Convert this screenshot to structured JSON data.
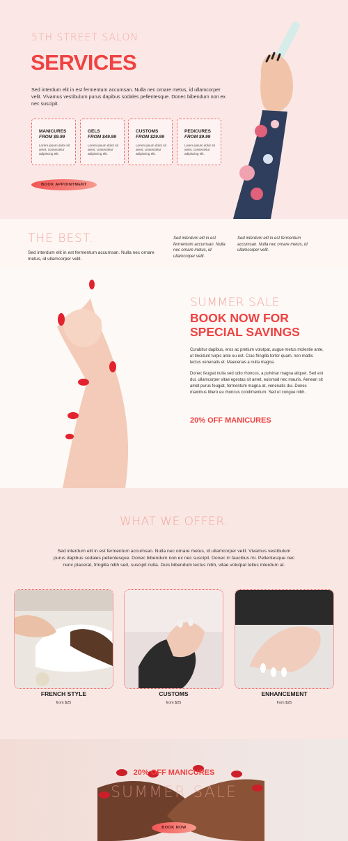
{
  "hero": {
    "eyebrow": "5TH STREET SALON",
    "title": "SERVICES",
    "text": "Sed interdum elit in est fermentum accumsan. Nulla nec ornare metus, id ullamcorper velit. Vivamus vestibulum purus dapibus sodales pellentesque. Donec bibendum non ex nec suscipit.",
    "cards": [
      {
        "name": "MANICURES",
        "price": "FROM $9.99",
        "desc": "Lorem ipsum dolor sit amet, consectetur adipiscing elit."
      },
      {
        "name": "GELS",
        "price": "FROM $49.99",
        "desc": "Lorem ipsum dolor sit amet, consectetur adipiscing elit."
      },
      {
        "name": "CUSTOMS",
        "price": "FROM $29.99",
        "desc": "Lorem ipsum dolor sit amet, consectetur adipiscing elit."
      },
      {
        "name": "PEDICURES",
        "price": "FROM $9.99",
        "desc": "Lorem ipsum dolor sit amet, consectetur adipiscing elit."
      }
    ],
    "button": "BOOK APPOINTMENT"
  },
  "best": {
    "title": "THE BEST.",
    "text": "Sed interdum elit in est fermentum accumsan. Nulla nec ornare metus, id ullamcorper velit.",
    "col1": "Sed interdum elit in est fermentum accumsan. Nulla nec ornare metus, id ullamcorper velit.",
    "col2": "Sed interdum elit in est fermentum accumsan. Nulla nec ornare metus, id ullamcorper velit."
  },
  "sale": {
    "eyebrow": "SUMMER SALE",
    "title": "BOOK NOW FOR SPECIAL SAVINGS",
    "p1": "Curabitur dapibus, eros ac pretium volutpat, augue metus molestie ante, ut tincidunt turpis ante eu est. Cras fringilla tortor quam, non mattis lectus venenatis et. Maecenas a nulla magna.",
    "p2": "Donec feugiat nulla sed odio rhoncus, a pulvinar magna aliquet. Sed est dui, ullamcorper vitae egestas sit amet, euismod nec mauris. Aenean sit amet purus feugiat, fermentum magna at, venenatis dui. Donec maximus libero eu rhoncus condimentum. Sed ut congue nibh.",
    "promo": "20% OFF MANICURES"
  },
  "offer": {
    "title": "WHAT WE OFFER.",
    "text": "Sed interdum elit in est fermentum accumsan. Nulla nec ornare metus, id ullamcorper velit. Vivamus vestibulum purus dapibus sodales pellentesque. Donec bibendum non ex nec suscipit. Donec in faucibus mi. Pellentesque nec nunc placerat, fringilla nibh sed, suscipit nulla. Duis bibendum lectus nibh, vitae volutpat tellus interdum at.",
    "items": [
      {
        "name": "FRENCH STYLE",
        "price": "from $25"
      },
      {
        "name": "CUSTOMS",
        "price": "from $25"
      },
      {
        "name": "ENHANCEMENT",
        "price": "from $25"
      }
    ]
  },
  "footer": {
    "promo": "20% OFF MANICURES",
    "ghost": "SUMMER SALE",
    "button": "BOOK NOW"
  },
  "colors": {
    "accent": "#ef4242",
    "soft_accent": "#f4a7a0",
    "hero_bg": "#fbe8e6"
  }
}
